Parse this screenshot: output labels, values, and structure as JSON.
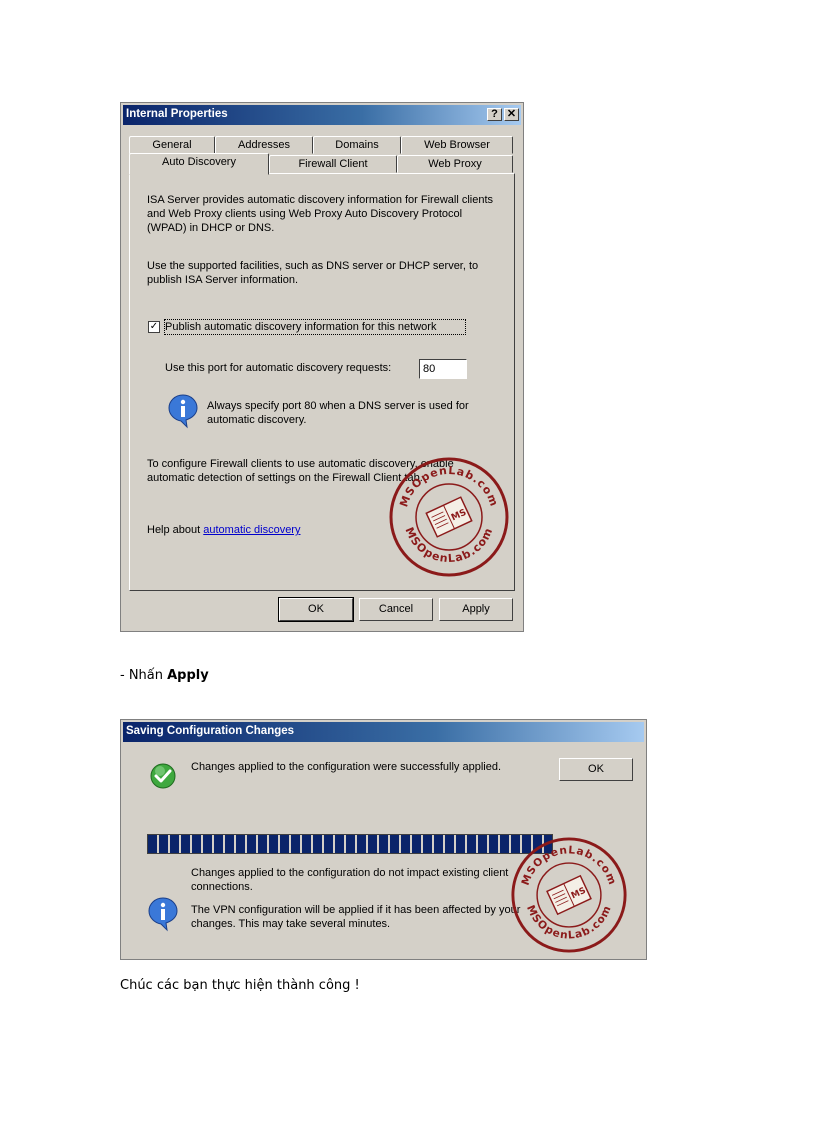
{
  "dialog1": {
    "title": "Internal Properties",
    "help_glyph": "?",
    "close_glyph": "✕",
    "tabs_row1": [
      "General",
      "Addresses",
      "Domains",
      "Web Browser"
    ],
    "tabs_row2": [
      "Auto Discovery",
      "Firewall Client",
      "Web Proxy"
    ],
    "active_tab": "Auto Discovery",
    "para1": "ISA Server provides automatic discovery information for Firewall clients and Web Proxy clients using Web Proxy Auto Discovery Protocol (WPAD) in DHCP or DNS.",
    "para2": "Use the supported facilities, such as DNS server or DHCP server, to publish ISA Server information.",
    "checkbox_label": "Publish automatic discovery information for this network",
    "checkbox_checked": true,
    "port_label": "Use this port for automatic discovery requests:",
    "port_value": "80",
    "info_text": "Always specify port 80 when a DNS server is used for automatic discovery.",
    "firewall_text": "To configure Firewall clients to use automatic discovery, enable automatic detection of settings on the Firewall Client tab.",
    "help_prefix": "Help about ",
    "help_link": "automatic discovery",
    "ok": "OK",
    "cancel": "Cancel",
    "apply": "Apply"
  },
  "caption1": {
    "prefix": "- Nhấn ",
    "bold": "Apply"
  },
  "dialog2": {
    "title": "Saving Configuration Changes",
    "success_text": "Changes applied to the configuration were successfully applied.",
    "ok": "OK",
    "progress_percent": 100,
    "impact_text": "Changes applied to the configuration do not impact existing client connections.",
    "vpn_text": "The VPN configuration will be applied if it has been affected by your changes. This may take several minutes."
  },
  "caption2": "Chúc các bạn thực hiện thành công !",
  "watermark": {
    "top": "MSOpenLab.com",
    "bottom": "MSOpenLab.com",
    "center": "MS"
  },
  "colors": {
    "dialog_bg": "#d4d0c8",
    "title_start": "#0a246a",
    "title_end": "#a6caf0",
    "link": "#0000cc",
    "stamp": "#8b1a1a",
    "progress": "#0a246a"
  }
}
